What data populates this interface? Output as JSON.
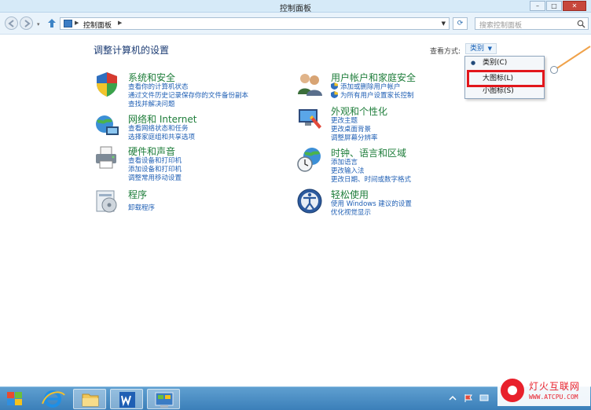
{
  "window": {
    "title": "控制面板"
  },
  "address": {
    "crumb": "控制面板",
    "search_placeholder": "搜索控制面板"
  },
  "content": {
    "heading": "调整计算机的设置",
    "view_by_label": "查看方式:",
    "view_by_value": "类别"
  },
  "view_menu": [
    {
      "label": "类别(C)",
      "selected": true
    },
    {
      "label": "大图标(L)",
      "selected": false
    },
    {
      "label": "小图标(S)",
      "selected": false
    }
  ],
  "categories": {
    "system": {
      "title": "系统和安全",
      "links": [
        "查看你的计算机状态",
        "通过文件历史记录保存你的文件备份副本",
        "查找并解决问题"
      ]
    },
    "network": {
      "title": "网络和 Internet",
      "links": [
        "查看网络状态和任务",
        "选择家庭组和共享选项"
      ]
    },
    "hardware": {
      "title": "硬件和声音",
      "links": [
        "查看设备和打印机",
        "添加设备和打印机",
        "调整常用移动设置"
      ]
    },
    "programs": {
      "title": "程序",
      "links": [
        "卸载程序"
      ]
    },
    "users": {
      "title": "用户帐户和家庭安全",
      "links": [
        "添加或删除用户帐户",
        "为所有用户设置家长控制"
      ]
    },
    "appearance": {
      "title": "外观和个性化",
      "links": [
        "更改主题",
        "更改桌面背景",
        "调整屏幕分辨率"
      ]
    },
    "clock": {
      "title": "时钟、语言和区域",
      "links": [
        "添加语言",
        "更改输入法",
        "更改日期、时间或数字格式"
      ]
    },
    "ease": {
      "title": "轻松使用",
      "links": [
        "使用 Windows 建议的设置",
        "优化视觉显示"
      ]
    }
  },
  "watermark": {
    "name": "灯火互联网",
    "url": "WWW.ATCPU.COM"
  }
}
